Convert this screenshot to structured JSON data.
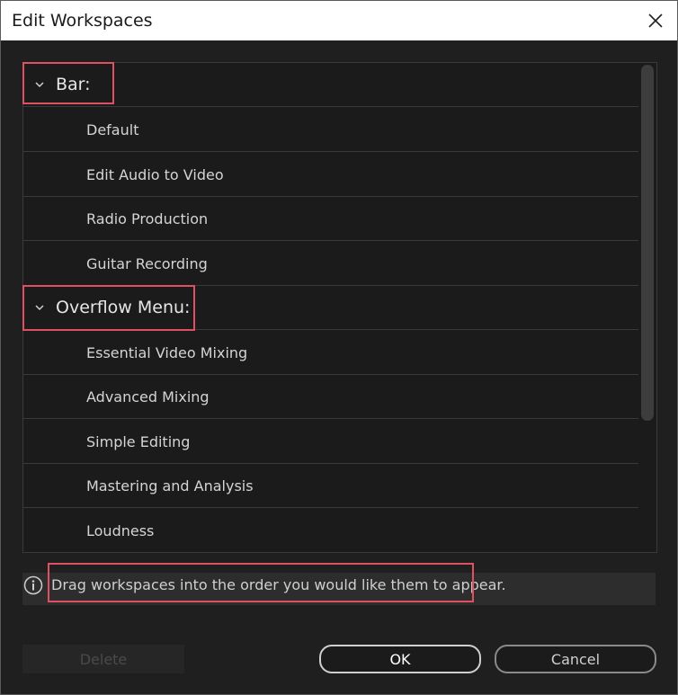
{
  "window": {
    "title": "Edit Workspaces"
  },
  "icons": {
    "close": "close-icon",
    "chevron": "chevron-down-icon",
    "info": "info-icon"
  },
  "groups": [
    {
      "label": "Bar:",
      "items": [
        "Default",
        "Edit Audio to Video",
        "Radio Production",
        "Guitar Recording"
      ]
    },
    {
      "label": "Overflow Menu:",
      "items": [
        "Essential Video Mixing",
        "Advanced Mixing",
        "Simple Editing",
        "Mastering and Analysis",
        "Loudness"
      ]
    }
  ],
  "info": {
    "text": "Drag workspaces into the order you would like them to appear."
  },
  "buttons": {
    "delete": "Delete",
    "ok": "OK",
    "cancel": "Cancel"
  },
  "colors": {
    "highlight": "#e05060",
    "background": "#1f1f1f"
  }
}
